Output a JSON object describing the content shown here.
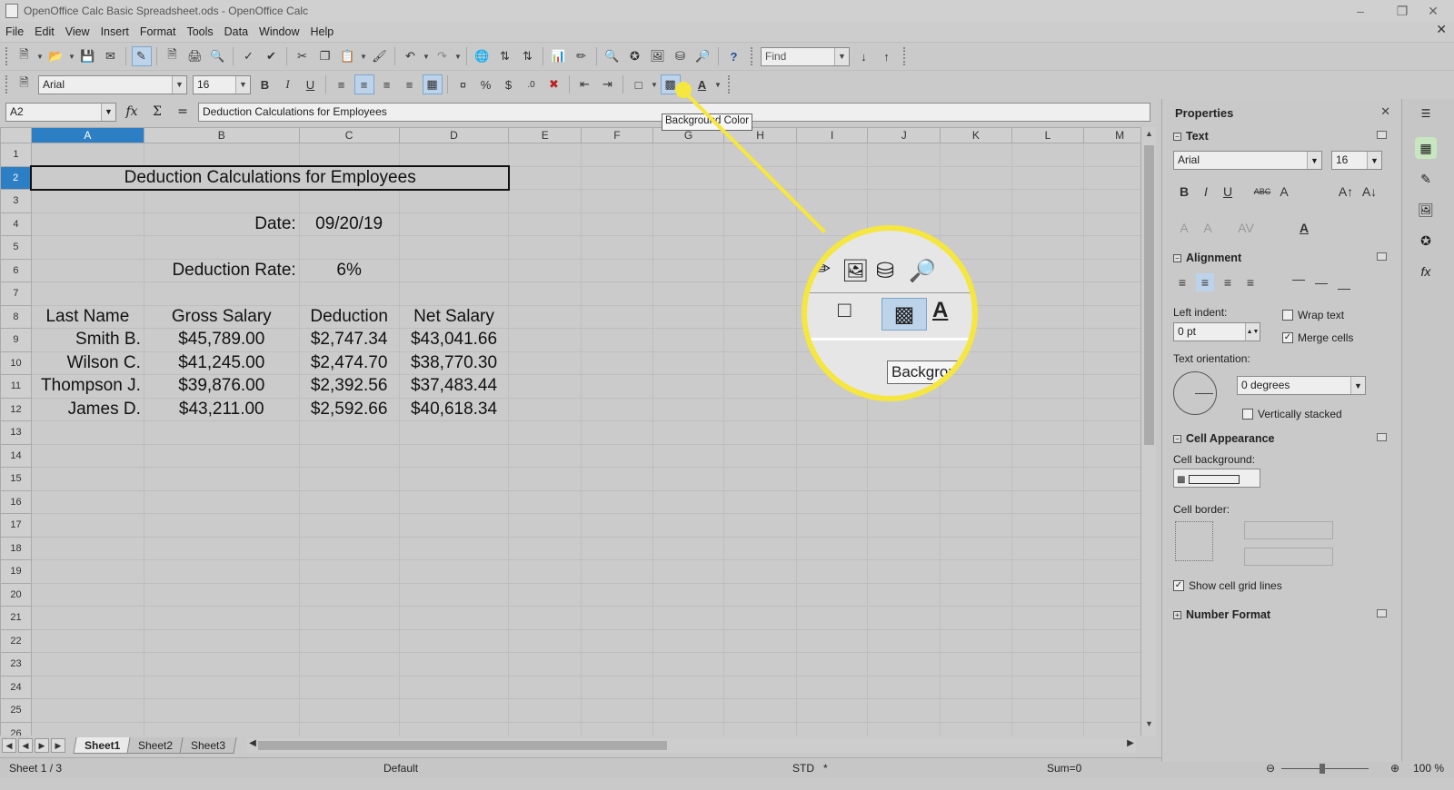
{
  "window": {
    "title": "OpenOffice Calc Basic Spreadsheet.ods - OpenOffice Calc",
    "minimize_icon": "minimize-icon",
    "restore_icon": "restore-icon",
    "close_icon": "close-icon"
  },
  "menu": [
    "File",
    "Edit",
    "View",
    "Insert",
    "Format",
    "Tools",
    "Data",
    "Window",
    "Help"
  ],
  "toolbar": {
    "find_placeholder": "Find",
    "font_name": "Arial",
    "font_size": "16",
    "bold": "B",
    "italic": "I",
    "underline": "U"
  },
  "tooltip": "Background Color",
  "formula": {
    "cell_ref": "A2",
    "content": "Deduction Calculations for Employees"
  },
  "columns": [
    "A",
    "B",
    "C",
    "D",
    "E",
    "F",
    "G",
    "H",
    "I",
    "J",
    "K",
    "L",
    "M"
  ],
  "active_column": "A",
  "active_row": "2",
  "rows": [
    "1",
    "2",
    "3",
    "4",
    "5",
    "6",
    "7",
    "8",
    "9",
    "10",
    "11",
    "12",
    "13",
    "14",
    "15",
    "16",
    "17",
    "18",
    "19",
    "20",
    "21",
    "22",
    "23",
    "24",
    "25",
    "26"
  ],
  "sheet": {
    "title": "Deduction Calculations for Employees",
    "date_label": "Date:",
    "date_value": "09/20/19",
    "rate_label": "Deduction Rate:",
    "rate_value": "6%",
    "headers": [
      "Last Name",
      "Gross Salary",
      "Deduction",
      "Net Salary"
    ],
    "data": [
      [
        "Smith B.",
        "$45,789.00",
        "$2,747.34",
        "$43,041.66"
      ],
      [
        "Wilson C.",
        "$41,245.00",
        "$2,474.70",
        "$38,770.30"
      ],
      [
        "Thompson J.",
        "$39,876.00",
        "$2,392.56",
        "$37,483.44"
      ],
      [
        "James D.",
        "$43,211.00",
        "$2,592.66",
        "$40,618.34"
      ]
    ]
  },
  "tabs": [
    "Sheet1",
    "Sheet2",
    "Sheet3"
  ],
  "active_tab": "Sheet1",
  "status": {
    "sheet_pos": "Sheet 1 / 3",
    "page_style": "Default",
    "mode": "STD",
    "modified": "*",
    "sum": "Sum=0",
    "zoom": "100 %"
  },
  "properties": {
    "title": "Properties",
    "text_section": "Text",
    "font_name": "Arial",
    "font_size": "16",
    "alignment_section": "Alignment",
    "left_indent_label": "Left indent:",
    "left_indent_value": "0 pt",
    "wrap_text": "Wrap text",
    "merge_cells": "Merge cells",
    "text_orientation_label": "Text orientation:",
    "orientation_value": "0 degrees",
    "vertically_stacked": "Vertically stacked",
    "cell_appearance_section": "Cell Appearance",
    "cell_background_label": "Cell background:",
    "cell_border_label": "Cell border:",
    "show_grid_lines": "Show cell grid lines",
    "number_format_section": "Number Format"
  },
  "zoom_callout": {
    "tooltip_text": "Backgrou"
  },
  "colors": {
    "highlight": "#f5e640",
    "selection": "#2d7fc5"
  }
}
